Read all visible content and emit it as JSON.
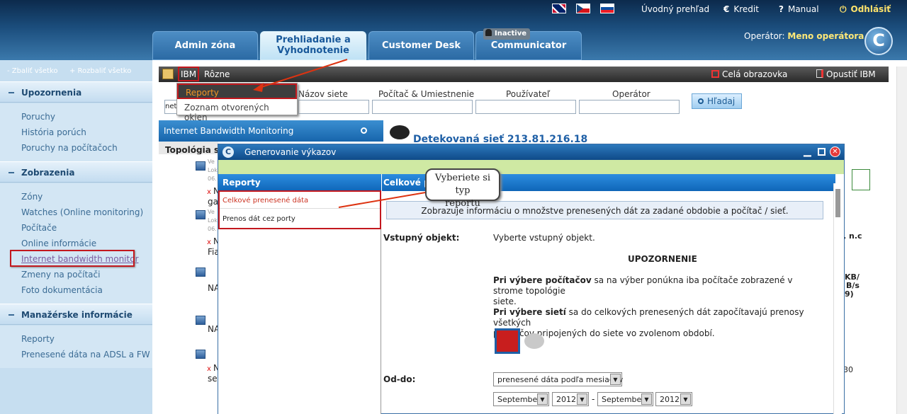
{
  "header": {
    "flags": [
      "uk-flag",
      "czech-flag",
      "slovak-flag"
    ],
    "links": {
      "home": "Úvodný prehľad",
      "credit": "Kredit",
      "manual": "Manual",
      "logout": "Odhlásiť"
    },
    "icons": {
      "credit": "€",
      "manual": "?",
      "logout": "⏻"
    },
    "tabs": {
      "admin": "Admin zóna",
      "browse_line1": "Prehliadanie a",
      "browse_line2": "Vyhodnotenie",
      "desk": "Customer Desk",
      "comm": "Communicator",
      "comm_badge": "Inactive"
    },
    "operator_label": "Operátor:",
    "operator_name": "Meno operátora",
    "logo": "C"
  },
  "sidebar": {
    "collapse": "- Zbaliť všetko",
    "expand": "+ Rozbaliť všetko",
    "sections": {
      "alerts": "Upozornenia",
      "views": "Zobrazenia",
      "mgmt": "Manažérske informácie"
    },
    "alerts_items": [
      "Poruchy",
      "História porúch",
      "Poruchy na počítačoch"
    ],
    "views_items": [
      "Zóny",
      "Watches (Online monitoring)",
      "Počítače",
      "Online informácie",
      "Internet bandwidth monitor",
      "Zmeny na počítači",
      "Foto dokumentácia"
    ],
    "mgmt_items": [
      "Reporty",
      "Prenesené dáta na ADSL a FW"
    ]
  },
  "toolbar": {
    "ibm": "IBM",
    "misc": "Rôzne",
    "fullscreen": "Celá obrazovka",
    "exit": "Opustiť IBM"
  },
  "dropdown": {
    "reports": "Reporty",
    "open_windows": "Zoznam otvorených okien"
  },
  "filters": {
    "net_name": "Názov siete",
    "pc_location": "Počítač & Umiestnenie",
    "user": "Používateľ",
    "operator": "Operátor",
    "first_value": "net",
    "search": "Hľadaj"
  },
  "monitor_panel": {
    "title": "Internet Bandwidth Monitoring",
    "topology": "Topológia siete"
  },
  "detected": "Detekovaná sieť 213.81.216.18",
  "topology_rows": [
    {
      "t": "Ve",
      "n": ""
    },
    {
      "t": "Lok",
      "n": ""
    },
    {
      "t": "06.",
      "n": ""
    },
    {
      "t": "x",
      "n": "N"
    },
    {
      "t": "",
      "n": "ga"
    },
    {
      "t": "Ve",
      "n": ""
    },
    {
      "t": "Lok",
      "n": ""
    },
    {
      "t": "06.",
      "n": ""
    },
    {
      "t": "x",
      "n": "N"
    },
    {
      "t": "",
      "n": "Fia"
    },
    {
      "t": "",
      "n": "NA"
    },
    {
      "t": "",
      "n": "NA"
    },
    {
      "t": "x",
      "n": "N"
    },
    {
      "t": "",
      "n": "se"
    }
  ],
  "right_fragments": {
    "nc": ", n.c",
    "kb": "KB/",
    "bs": "B/s",
    "nine": "9)",
    "thirty": "30"
  },
  "dialog": {
    "title": "Generovanie výkazov",
    "reports_header": "Reporty",
    "report_items": [
      "Celkové prenesené dáta",
      "Prenos dát cez porty"
    ],
    "content_header": "Celkové pre",
    "info": "Zobrazuje informáciu o množstve prenesených dát za zadané obdobie a počítač / sieť.",
    "input_label": "Vstupný objekt:",
    "input_value": "Vyberte vstupný objekt.",
    "warn_title": "UPOZORNENIE",
    "warn1_bold": "Pri výbere počítačov",
    "warn1_rest": " sa na výber ponúkna iba počítače zobrazené v strome topológie",
    "warn1_line2": "siete.",
    "warn2_bold": "Pri výbere sietí",
    "warn2_rest": " sa do celkových prenesených dát započítavajú prenosy všetkých",
    "warn2_line2": "počítačov pripojených do siete vo zvolenom období.",
    "period_label": "Od-do:",
    "period_type": "prenesené dáta podľa mesiacov",
    "from_month": "September",
    "from_year": "2012",
    "sep": "-",
    "to_month": "September",
    "to_year": "2012"
  },
  "callout": {
    "line1": "Vyberiete si typ",
    "line2": "reportu"
  },
  "colors": {
    "accent": "#1765ac",
    "highlight": "#c3181e",
    "brand_orange": "#f39422"
  }
}
